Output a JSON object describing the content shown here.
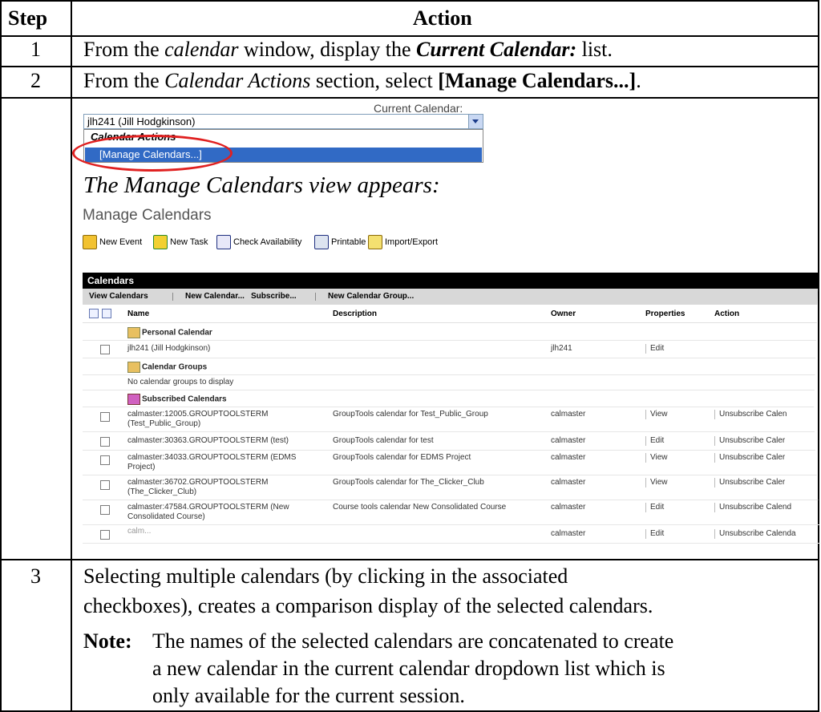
{
  "table": {
    "header_step": "Step",
    "header_action": "Action",
    "rows": [
      {
        "step": "1",
        "action": {
          "a": "From the ",
          "b_italic": "calendar",
          "c": " window, display the ",
          "d_bold_italic": "Current Calendar:",
          "e": " list."
        }
      },
      {
        "step": "2",
        "action": {
          "a": "From the ",
          "b_italic": "Calendar Actions",
          "c": " section, select ",
          "d_bold": "[Manage Calendars...]",
          "e": "."
        },
        "appears_text": "The Manage Calendars view appears:"
      },
      {
        "step": "3",
        "line1": "Selecting multiple calendars (by clicking in the associated",
        "line2": "checkboxes), creates a comparison display of the selected calendars.",
        "note_label": "Note:",
        "note_line1": "The names of the selected calendars are concatenated to create",
        "note_line2": "a new calendar in the current calendar dropdown list which is",
        "note_line3": "only available for the current session."
      }
    ]
  },
  "dropdown_shot": {
    "label": "Current Calendar:",
    "selected": "jlh241 (Jill Hodgkinson)",
    "group_label": "Calendar Actions",
    "highlighted_item": "[Manage Calendars...]",
    "highlight_color": "#316ac5",
    "annotation_color": "#e02020"
  },
  "manage_shot": {
    "title": "Manage Calendars",
    "toolbar": [
      {
        "label": "New Event",
        "icon": "new-event-icon"
      },
      {
        "label": "New Task",
        "icon": "new-task-icon"
      },
      {
        "label": "Check Availability",
        "icon": "check-availability-icon"
      },
      {
        "label": "Printable",
        "icon": "printer-icon"
      },
      {
        "label": "Import/Export",
        "icon": "import-export-icon"
      }
    ],
    "section_title": "Calendars",
    "tabs": [
      "View Calendars",
      "New Calendar...",
      "Subscribe...",
      "New Calendar Group..."
    ],
    "columns": [
      "Name",
      "Description",
      "Owner",
      "Properties",
      "Action"
    ],
    "rows": [
      {
        "type": "section",
        "name": "Personal Calendar"
      },
      {
        "type": "item",
        "name": "jlh241 (Jill Hodgkinson)",
        "name2": "",
        "description": "",
        "owner": "jlh241",
        "properties": "Edit",
        "action": ""
      },
      {
        "type": "section",
        "name": "Calendar Groups"
      },
      {
        "type": "empty",
        "name": "No calendar groups to display"
      },
      {
        "type": "section",
        "name": "Subscribed Calendars"
      },
      {
        "type": "item",
        "name": "calmaster:12005.GROUPTOOLSTERM",
        "name2": "(Test_Public_Group)",
        "description": "GroupTools calendar for Test_Public_Group",
        "owner": "calmaster",
        "properties": "View",
        "action": "Unsubscribe Calen"
      },
      {
        "type": "item",
        "name": "calmaster:30363.GROUPTOOLSTERM (test)",
        "name2": "",
        "description": "GroupTools calendar for test",
        "owner": "calmaster",
        "properties": "Edit",
        "action": "Unsubscribe Caler"
      },
      {
        "type": "item",
        "name": "calmaster:34033.GROUPTOOLSTERM (EDMS",
        "name2": "Project)",
        "description": "GroupTools calendar for EDMS Project",
        "owner": "calmaster",
        "properties": "View",
        "action": "Unsubscribe Caler"
      },
      {
        "type": "item",
        "name": "calmaster:36702.GROUPTOOLSTERM",
        "name2": "(The_Clicker_Club)",
        "description": "GroupTools calendar for The_Clicker_Club",
        "owner": "calmaster",
        "properties": "View",
        "action": "Unsubscribe Caler"
      },
      {
        "type": "item",
        "name": "calmaster:47584.GROUPTOOLSTERM (New",
        "name2": "Consolidated Course)",
        "description": "Course tools calendar New Consolidated Course",
        "owner": "calmaster",
        "properties": "Edit",
        "action": "Unsubscribe Calend"
      },
      {
        "type": "item",
        "name": "calm...",
        "name2": "",
        "description": "",
        "owner": "calmaster",
        "properties": "Edit",
        "action": "Unsubscribe Calenda"
      }
    ]
  }
}
